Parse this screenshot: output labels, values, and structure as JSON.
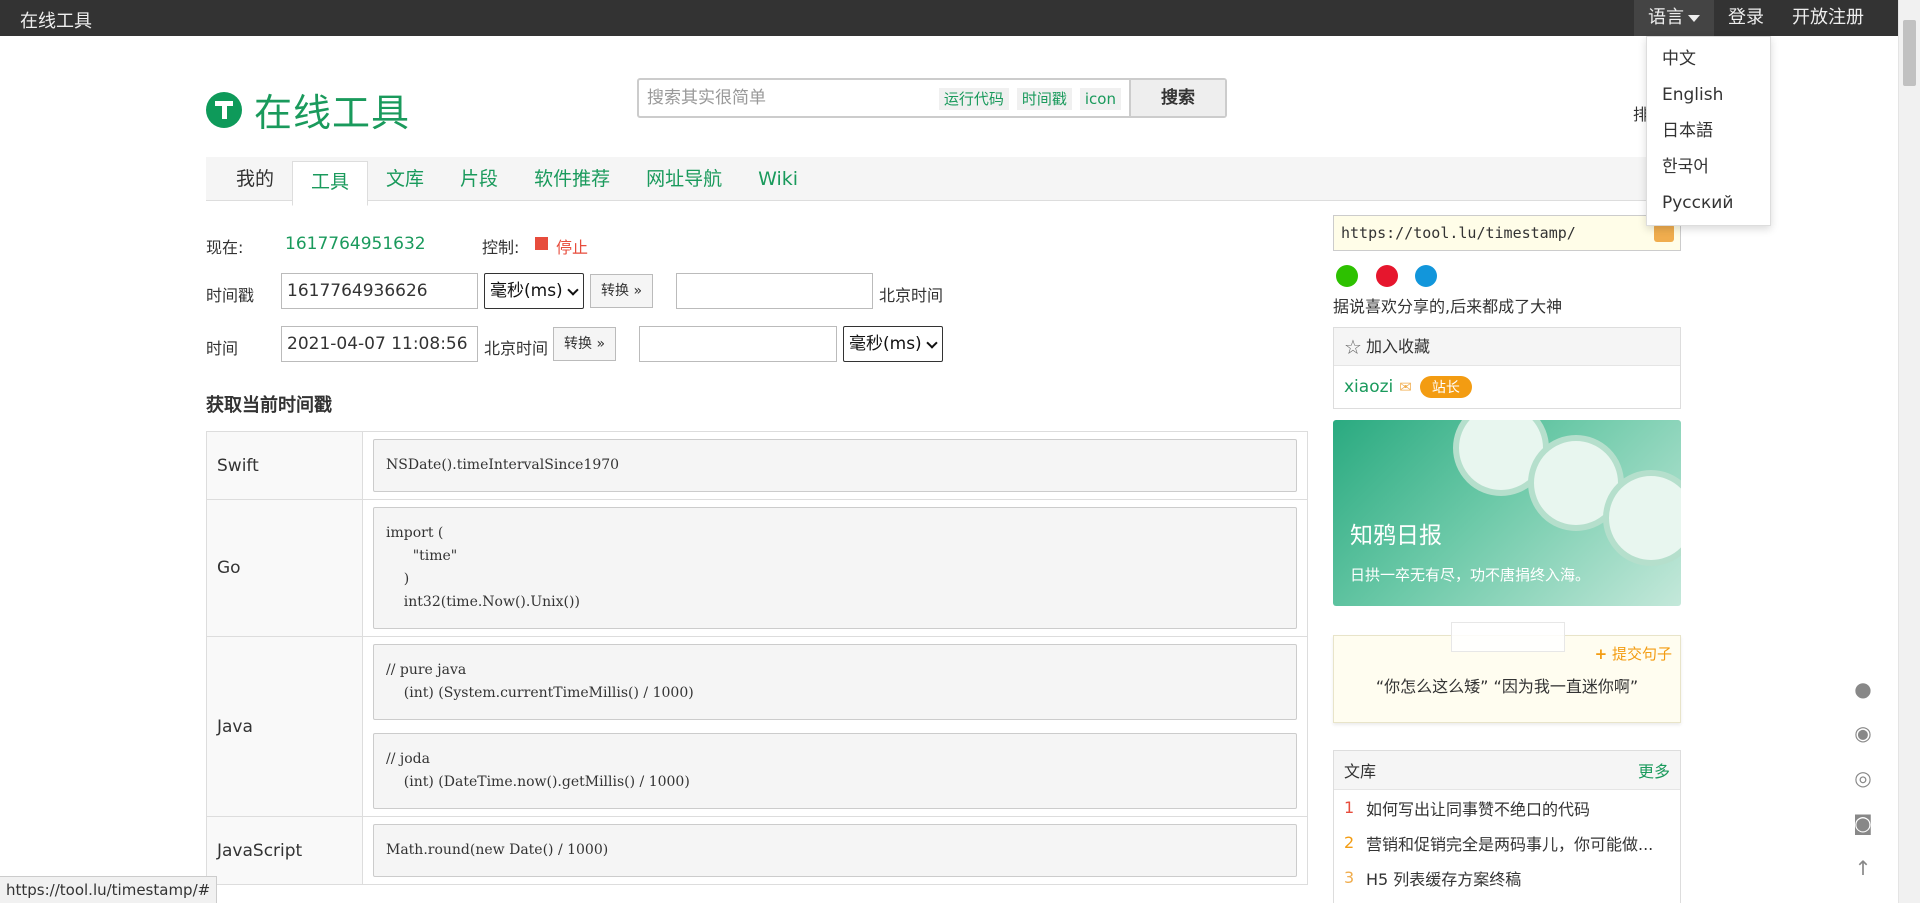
{
  "topbar": {
    "brand": "在线工具",
    "language": "语言",
    "login": "登录",
    "register": "开放注册"
  },
  "language_menu": [
    "中文",
    "English",
    "日本語",
    "한국어",
    "Русский"
  ],
  "header": {
    "logo_text": "在线工具",
    "search_placeholder": "搜索其实很简单",
    "search_tags": [
      "运行代码",
      "时间戳",
      "icon"
    ],
    "search_button": "搜索",
    "clipped_text": "排"
  },
  "nav": {
    "tabs": [
      "我的",
      "工具",
      "文库",
      "片段",
      "软件推荐",
      "网址导航",
      "Wiki"
    ],
    "active": "工具"
  },
  "converter": {
    "now_label": "现在:",
    "now_value": "1617764951632",
    "control_label": "控制:",
    "stop_label": "停止",
    "timestamp_label": "时间戳",
    "timestamp_value": "1617764936626",
    "unit_ms": "毫秒(ms)",
    "convert_button": "转换 »",
    "beijing_time": "北京时间",
    "time_label": "时间",
    "time_value": "2021-04-07 11:08:56",
    "unit_ms_2": "毫秒(ms)"
  },
  "section_title": "获取当前时间戳",
  "code_rows": [
    {
      "lang": "Swift",
      "codes": [
        "NSDate().timeIntervalSince1970"
      ]
    },
    {
      "lang": "Go",
      "codes": [
        "import (\n      \"time\"\n    )\n    int32(time.Now().Unix())"
      ]
    },
    {
      "lang": "Java",
      "codes": [
        "// pure java\n    (int) (System.currentTimeMillis() / 1000)",
        "// joda\n    (int) (DateTime.now().getMillis() / 1000)"
      ]
    },
    {
      "lang": "JavaScript",
      "codes": [
        "Math.round(new Date() / 1000)"
      ]
    }
  ],
  "sidebar": {
    "share_url": "https://tool.lu/timestamp/",
    "share_note": "据说喜欢分享的,后来都成了大神",
    "favorite": "加入收藏",
    "user": "xiaozi",
    "user_badge": "站长",
    "promo_title": "知鸦日报",
    "promo_subtitle": "日拱一卒无有尽，功不唐捐终入海。",
    "quote_submit": "提交句子",
    "quote_text": "“你怎么这么矮” “因为我一直迷你啊”",
    "library_title": "文库",
    "library_more": "更多",
    "library_items": [
      {
        "num": "1",
        "title": "如何写出让同事赞不绝口的代码"
      },
      {
        "num": "2",
        "title": "营销和促销完全是两码事儿，你可能做..."
      },
      {
        "num": "3",
        "title": "H5 列表缓存方案终稿"
      }
    ]
  },
  "statusbar_url": "https://tool.lu/timestamp/#",
  "colors": {
    "brand_green": "#1a9a5c",
    "topbar_bg": "#333333",
    "stop_red": "#e74c3c",
    "badge_orange": "#f39c12"
  }
}
